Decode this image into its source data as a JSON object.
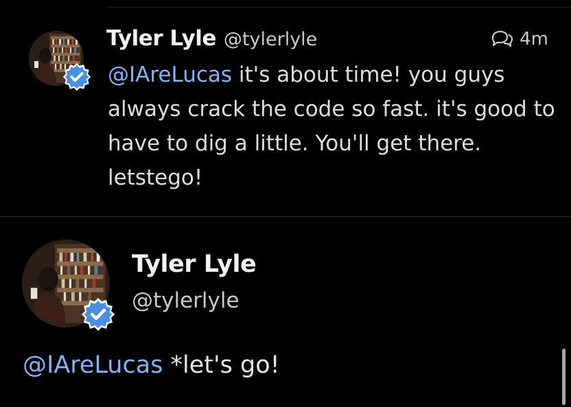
{
  "tweet": {
    "display_name": "Tyler Lyle",
    "handle": "@tylerlyle",
    "time": "4m",
    "mention": "@IAreLucas",
    "text": " it's about time! you guys always crack the code so fast. it's good to have to dig a little. You'll get there. letstego!"
  },
  "detail": {
    "display_name": "Tyler Lyle",
    "handle": "@tylerlyle",
    "mention": "@IAreLucas",
    "text": " *let's go!"
  },
  "icons": {
    "reply_indicator": "conversation-icon",
    "verified": "verified-badge-icon",
    "verified_color": "#4a90e2"
  },
  "colors": {
    "background": "#000000",
    "mention": "#7fb3f5"
  }
}
